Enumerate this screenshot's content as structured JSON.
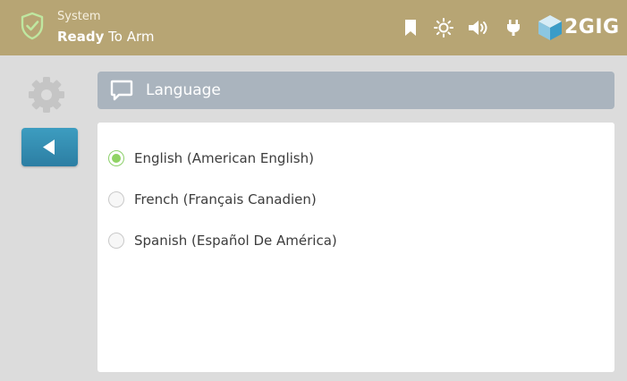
{
  "status": {
    "system_label": "System",
    "state_bold": "Ready",
    "state_rest": " To Arm"
  },
  "brand": {
    "logo_text": "2GIG",
    "accent_color": "#b7a574"
  },
  "topbar_icons": [
    "bookmark-icon",
    "brightness-icon",
    "volume-icon",
    "power-plug-icon",
    "brand-cube-icon"
  ],
  "page": {
    "title": "Language",
    "title_icon": "speech-bubble-icon"
  },
  "nav": {
    "settings_icon": "gear-icon",
    "back_icon": "back-arrow-icon",
    "back_color": "#3a95bb"
  },
  "languages": {
    "selected_index": 0,
    "options": [
      {
        "label": "English (American English)",
        "selected": true
      },
      {
        "label": "French (Français Canadien)",
        "selected": false
      },
      {
        "label": "Spanish (Español De América)",
        "selected": false
      }
    ]
  }
}
